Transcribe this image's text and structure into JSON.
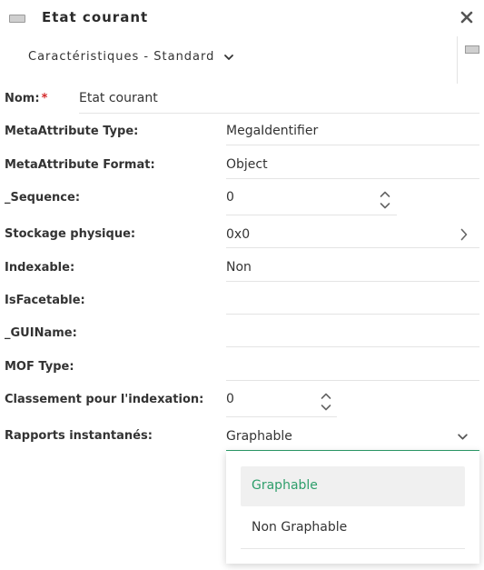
{
  "header": {
    "title": "Etat courant"
  },
  "view_selector": {
    "label": "Caractéristiques - Standard"
  },
  "fields": {
    "nom": {
      "label": "Nom:",
      "required_mark": "*",
      "value": "Etat courant"
    },
    "metaattribute_type": {
      "label": "MetaAttribute Type:",
      "value": "MegaIdentifier"
    },
    "metaattribute_format": {
      "label": "MetaAttribute Format:",
      "value": "Object"
    },
    "sequence": {
      "label": "_Sequence:",
      "value": "0"
    },
    "stockage_physique": {
      "label": "Stockage physique:",
      "value": "0x0"
    },
    "indexable": {
      "label": "Indexable:",
      "value": "Non"
    },
    "isfacetable": {
      "label": "IsFacetable:",
      "value": ""
    },
    "guiname": {
      "label": "_GUIName:",
      "value": ""
    },
    "mof_type": {
      "label": "MOF Type:",
      "value": ""
    },
    "classement": {
      "label": "Classement pour l'indexation:",
      "value": "0"
    },
    "rapports": {
      "label": "Rapports instantanés:",
      "value": "Graphable"
    }
  },
  "dropdown": {
    "options": [
      "Graphable",
      "Non Graphable"
    ],
    "selected": "Graphable"
  },
  "colors": {
    "accent": "#2e9e6b",
    "required": "#d4292a",
    "selected_bg": "#f0f0f0"
  }
}
